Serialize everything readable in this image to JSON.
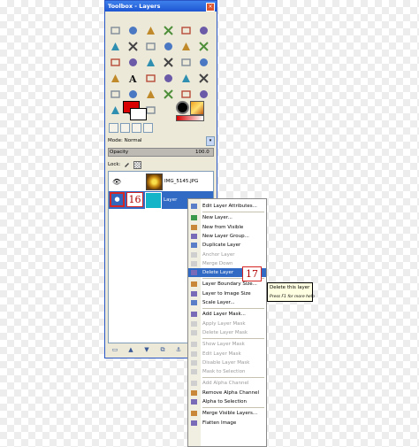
{
  "window": {
    "title": "Toolbox - Layers",
    "close_symbol": "×"
  },
  "tools": [
    "rect-select",
    "ellipse-select",
    "free-select",
    "fuzzy-select",
    "select-by-color",
    "scissors",
    "foreground-select",
    "paths",
    "color-picker",
    "zoom",
    "measure",
    "move",
    "align",
    "crop",
    "rotate",
    "scale",
    "shear",
    "perspective",
    "flip",
    "text",
    "bucket-fill",
    "blend",
    "pencil",
    "paintbrush",
    "eraser",
    "airbrush",
    "ink",
    "clone",
    "heal",
    "perspective-clone",
    "blur",
    "smudge",
    "dodge-burn"
  ],
  "colors": {
    "foreground": "#d80000",
    "background": "#ffffff",
    "accent": "#316ac5",
    "callout": "#d62525"
  },
  "layers_panel": {
    "mode_label": "Mode: Normal",
    "mode_arrow": "▾",
    "opacity_label": "Opacity",
    "opacity_value": "100.0",
    "lock_label": "Lock:",
    "layers": [
      {
        "name": "IMG_5145.JPG",
        "visible_icon": "eye-icon"
      },
      {
        "name": "Layer",
        "selected": true,
        "visible_icon": "eye-icon"
      }
    ]
  },
  "callouts": {
    "first": "16",
    "second": "17"
  },
  "bottom_bar": [
    "new-layer",
    "raise-layer",
    "lower-layer",
    "duplicate-layer",
    "anchor-layer",
    "delete-layer"
  ],
  "context_menu": {
    "groups": [
      [
        {
          "label": "Edit Layer Attributes...",
          "enabled": true
        }
      ],
      [
        {
          "label": "New Layer...",
          "enabled": true
        },
        {
          "label": "New from Visible",
          "enabled": true
        },
        {
          "label": "New Layer Group...",
          "enabled": true
        },
        {
          "label": "Duplicate Layer",
          "enabled": true
        },
        {
          "label": "Anchor Layer",
          "enabled": false
        },
        {
          "label": "Merge Down",
          "enabled": false
        },
        {
          "label": "Delete Layer",
          "enabled": true,
          "highlighted": true
        }
      ],
      [
        {
          "label": "Layer Boundary Size...",
          "enabled": true
        },
        {
          "label": "Layer to Image Size",
          "enabled": true
        },
        {
          "label": "Scale Layer...",
          "enabled": true
        }
      ],
      [
        {
          "label": "Add Layer Mask...",
          "enabled": true
        },
        {
          "label": "Apply Layer Mask",
          "enabled": false
        },
        {
          "label": "Delete Layer Mask",
          "enabled": false
        }
      ],
      [
        {
          "label": "Show Layer Mask",
          "enabled": false
        },
        {
          "label": "Edit Layer Mask",
          "enabled": false
        },
        {
          "label": "Disable Layer Mask",
          "enabled": false
        },
        {
          "label": "Mask to Selection",
          "enabled": false
        }
      ],
      [
        {
          "label": "Add Alpha Channel",
          "enabled": false
        },
        {
          "label": "Remove Alpha Channel",
          "enabled": true
        },
        {
          "label": "Alpha to Selection",
          "enabled": true
        }
      ],
      [
        {
          "label": "Merge Visible Layers...",
          "enabled": true
        },
        {
          "label": "Flatten Image",
          "enabled": true
        }
      ]
    ]
  },
  "tooltip": {
    "text": "Delete this layer",
    "hint": "Press F1 for more help"
  }
}
